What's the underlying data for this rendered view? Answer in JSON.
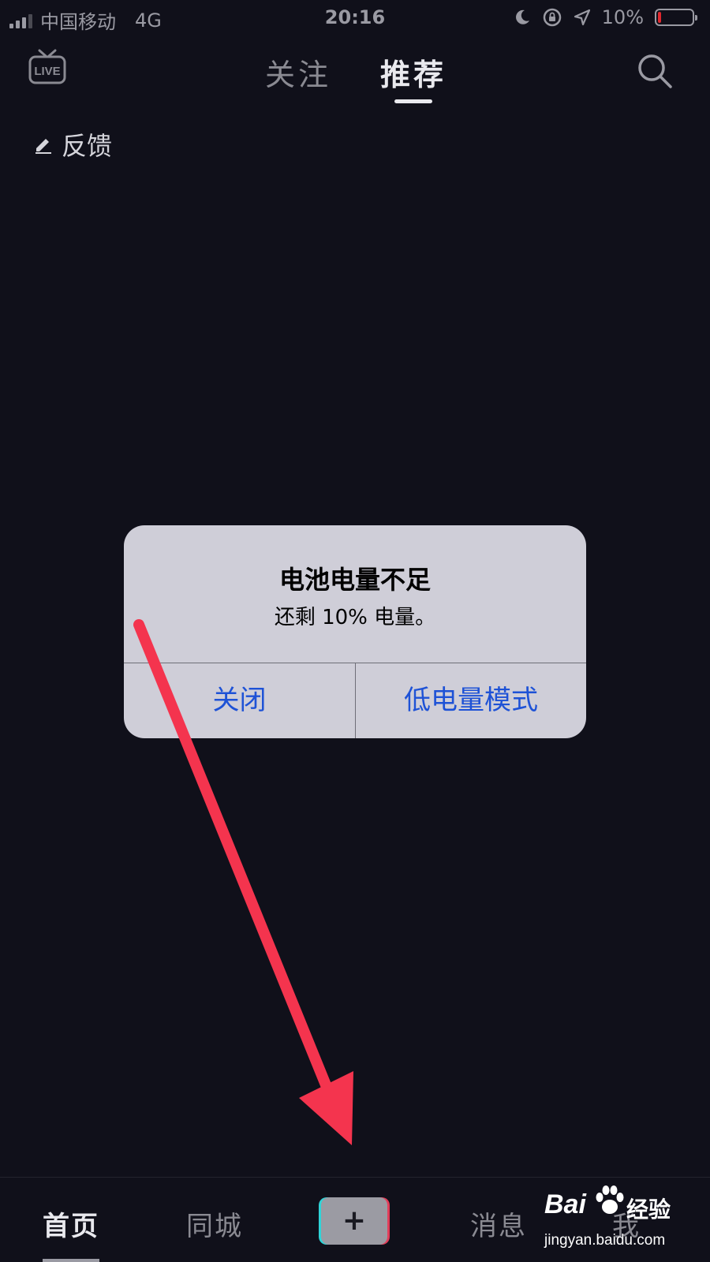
{
  "status_bar": {
    "carrier": "中国移动",
    "network": "4G",
    "time": "20:16",
    "battery_text": "10%",
    "battery_level": 0.1,
    "battery_color": "#e0282e",
    "icons": [
      "signal-icon",
      "moon-icon",
      "rotation-lock-icon",
      "location-icon",
      "battery-icon"
    ]
  },
  "header": {
    "live_label": "LIVE",
    "tabs": [
      {
        "label": "关注",
        "active": false
      },
      {
        "label": "推荐",
        "active": true
      }
    ],
    "feedback_label": "反馈"
  },
  "alert": {
    "title": "电池电量不足",
    "message": "还剩 10% 电量。",
    "buttons": [
      {
        "label": "关闭"
      },
      {
        "label": "低电量模式"
      }
    ],
    "button_color": "#1e52d6"
  },
  "bottom_nav": {
    "items": [
      {
        "label": "首页",
        "active": true
      },
      {
        "label": "同城",
        "active": false
      },
      {
        "label": "+",
        "active": false
      },
      {
        "label": "消息",
        "active": false
      },
      {
        "label": "我",
        "active": false
      }
    ]
  },
  "watermark": {
    "logo": "Bai",
    "title": "经验",
    "url": "jingyan.baidu.com"
  },
  "annotation": {
    "arrow_color": "#f4344e"
  }
}
